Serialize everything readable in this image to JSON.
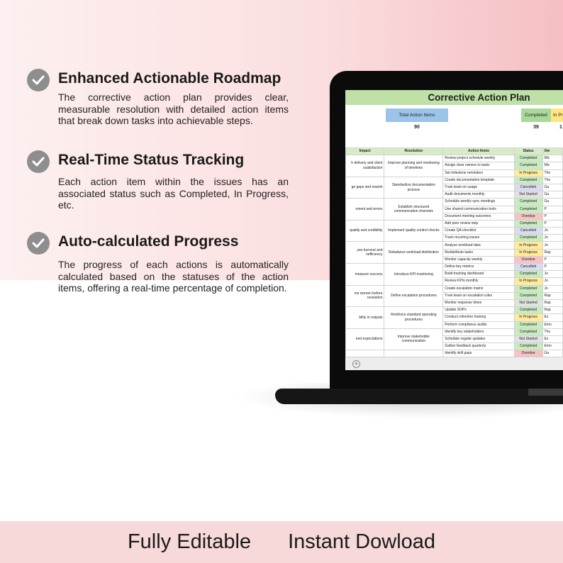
{
  "features": [
    {
      "title": "Enhanced Actionable Roadmap",
      "description": "The corrective action plan provides clear, measurable resolution with detailed action items that break down tasks into achievable steps."
    },
    {
      "title": "Real-Time Status Tracking",
      "description": "Each action item within the issues has an associated status such as Completed, In Progress, etc."
    },
    {
      "title": "Auto-calculated Progress",
      "description": "The progress of each actions is automatically calculated based on the statuses of the action items, offering a real-time percentage of completion."
    }
  ],
  "footer": {
    "left": "Fully Editable",
    "right": "Instant Dowload"
  },
  "sheet": {
    "title": "Corrective Action Plan",
    "kpis": {
      "total_label": "Total Action Items",
      "total_value": "90",
      "completed_label": "Completed",
      "completed_value": "39",
      "inprogress_label": "In Pro",
      "inprogress_value": "1"
    },
    "headers": [
      "Impact",
      "Resolution",
      "Action Items",
      "Status",
      "Ow"
    ],
    "groups": [
      {
        "impact": "h delivery and client ssatisfaction",
        "resolution": "Improve planning and monitoring of timelines",
        "rows": [
          [
            "Review project schedule weekly",
            "Completed",
            "Mic"
          ],
          [
            "Assign clear owners to tasks",
            "Completed",
            "Mic"
          ],
          [
            "Set milestone reminders",
            "In Progress",
            "Tho"
          ]
        ]
      },
      {
        "impact": "ge gaps and rework",
        "resolution": "Standardize documentation process",
        "rows": [
          [
            "Create documentation template",
            "Completed",
            "Tho"
          ],
          [
            "Train team on usage",
            "Cancelled",
            "Ga"
          ],
          [
            "Audit documents monthly",
            "Not Started",
            "Ga"
          ]
        ]
      },
      {
        "impact": "nment and errors",
        "resolution": "Establish structured communication channels",
        "rows": [
          [
            "Schedule weekly sync meetings",
            "Completed",
            "Ga"
          ],
          [
            "Use shared communication tools",
            "Completed",
            "P"
          ],
          [
            "Document meeting outcomes",
            "Overdue",
            "P"
          ]
        ]
      },
      {
        "impact": "quality and credibility",
        "resolution": "Implement quality control checks",
        "rows": [
          [
            "Add peer review step",
            "Completed",
            "P"
          ],
          [
            "Create QA checklist",
            "Cancelled",
            "Jo"
          ],
          [
            "Track recurring issues",
            "Completed",
            "Jo"
          ]
        ]
      },
      {
        "impact": "yee burnout and nefficiency",
        "resolution": "Rebalance workload distribution",
        "rows": [
          [
            "Analyze workload data",
            "In Progress",
            "Jo"
          ],
          [
            "Redistribute tasks",
            "In Progress",
            "Rap"
          ],
          [
            "Monitor capacity weekly",
            "Overdue",
            "P"
          ]
        ]
      },
      {
        "impact": "measure success",
        "resolution": "Introduce KPI monitoring",
        "rows": [
          [
            "Define key metrics",
            "Cancelled",
            "P"
          ],
          [
            "Build tracking dashboard",
            "Completed",
            "Jo"
          ],
          [
            "Review KPIs monthly",
            "In Progress",
            "Jo"
          ]
        ]
      },
      {
        "impact": "ms worsen before resolution",
        "resolution": "Define escalation procedures",
        "rows": [
          [
            "Create escalation matrix",
            "Completed",
            "Jo"
          ],
          [
            "Train team on escalation rules",
            "Completed",
            "Rap"
          ],
          [
            "Monitor response times",
            "Not Started",
            "Rap"
          ]
        ]
      },
      {
        "impact": "bility in outputs",
        "resolution": "Reinforce standard operating procedures",
        "rows": [
          [
            "Update SOPs",
            "Completed",
            "Rap"
          ],
          [
            "Conduct refresher training",
            "In Progress",
            "Ez"
          ],
          [
            "Perform compliance audits",
            "Completed",
            "Emn"
          ]
        ]
      },
      {
        "impact": "ned expectations",
        "resolution": "Improve stakeholder communication",
        "rows": [
          [
            "Identify key stakeholders",
            "Completed",
            "Thu"
          ],
          [
            "Schedule regular updates",
            "Not Started",
            "Ez"
          ],
          [
            "Gather feedback quarterly",
            "Completed",
            "Emn"
          ]
        ]
      },
      {
        "impact": "",
        "resolution": "",
        "rows": [
          [
            "Identify skill gaps",
            "Overdue",
            "Ga"
          ]
        ]
      }
    ]
  },
  "colors": {
    "title_bar": "#bfe0a6",
    "total_kpi": "#9cc3e8",
    "completed_kpi": "#a8d89a",
    "inprogress_kpi": "#ffe680",
    "footer": "#f6d9d8"
  },
  "icons": {
    "check": "check-circle-icon",
    "add_sheet": "plus-circle-icon"
  }
}
